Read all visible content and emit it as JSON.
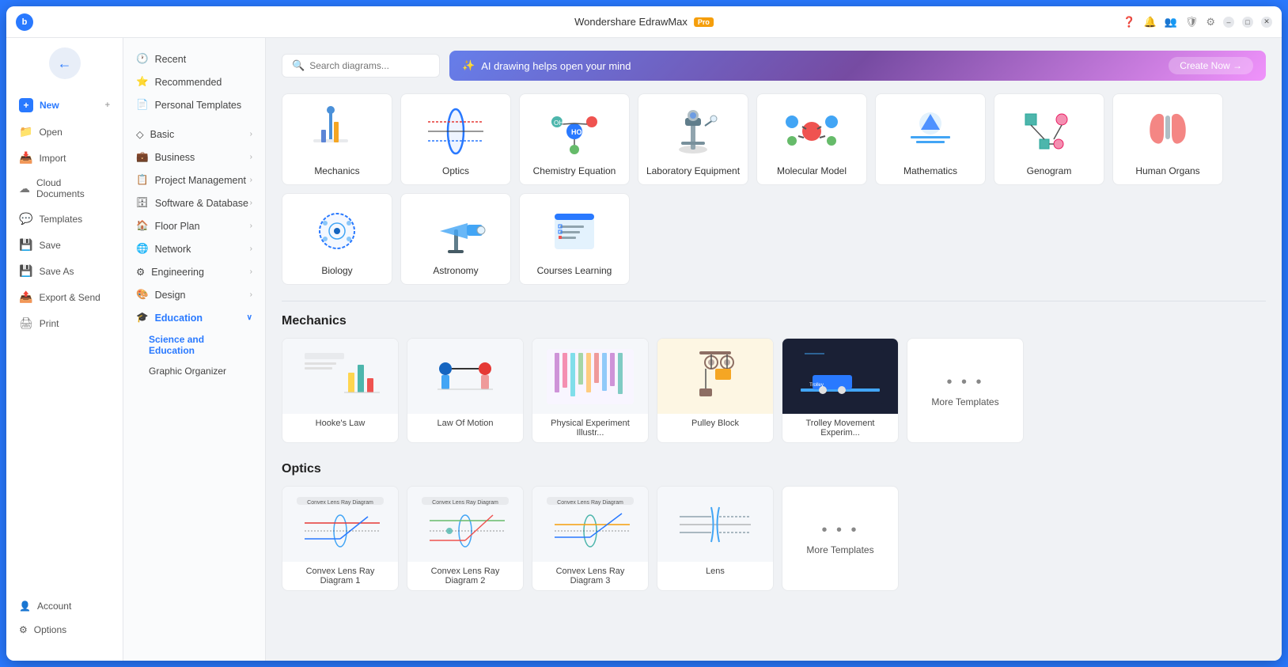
{
  "app": {
    "title": "Wondershare EdrawMax",
    "badge": "Pro",
    "avatar": "b"
  },
  "titlebar": {
    "icons": [
      "help",
      "bell",
      "people",
      "shield",
      "settings"
    ]
  },
  "left_sidebar": {
    "items": [
      {
        "id": "new",
        "label": "New",
        "icon": "+"
      },
      {
        "id": "open",
        "label": "Open",
        "icon": "📁"
      },
      {
        "id": "import",
        "label": "Import",
        "icon": "📥"
      },
      {
        "id": "cloud",
        "label": "Cloud Documents",
        "icon": "☁"
      },
      {
        "id": "templates",
        "label": "Templates",
        "icon": "💬"
      },
      {
        "id": "save",
        "label": "Save",
        "icon": "💾"
      },
      {
        "id": "save-as",
        "label": "Save As",
        "icon": "💾"
      },
      {
        "id": "export",
        "label": "Export & Send",
        "icon": "📤"
      },
      {
        "id": "print",
        "label": "Print",
        "icon": "🖨"
      }
    ],
    "bottom": [
      {
        "id": "account",
        "label": "Account",
        "icon": "👤"
      },
      {
        "id": "options",
        "label": "Options",
        "icon": "⚙"
      }
    ]
  },
  "main_sidebar": {
    "items": [
      {
        "id": "recent",
        "label": "Recent",
        "icon": "🕐",
        "has_sub": false
      },
      {
        "id": "recommended",
        "label": "Recommended",
        "icon": "⭐",
        "has_sub": false
      },
      {
        "id": "personal",
        "label": "Personal Templates",
        "icon": "📄",
        "has_sub": false
      },
      {
        "id": "basic",
        "label": "Basic",
        "icon": "◇",
        "has_chevron": true
      },
      {
        "id": "business",
        "label": "Business",
        "icon": "💼",
        "has_chevron": true
      },
      {
        "id": "project",
        "label": "Project Management",
        "icon": "📋",
        "has_chevron": true
      },
      {
        "id": "software",
        "label": "Software & Database",
        "icon": "🗄",
        "has_chevron": true
      },
      {
        "id": "floor",
        "label": "Floor Plan",
        "icon": "🏠",
        "has_chevron": true
      },
      {
        "id": "network",
        "label": "Network",
        "icon": "🌐",
        "has_chevron": true
      },
      {
        "id": "engineering",
        "label": "Engineering",
        "icon": "⚙",
        "has_chevron": true
      },
      {
        "id": "design",
        "label": "Design",
        "icon": "🎨",
        "has_chevron": true
      },
      {
        "id": "education",
        "label": "Education",
        "icon": "🎓",
        "has_chevron": true,
        "active": true
      }
    ],
    "sub_items": [
      {
        "id": "science",
        "label": "Science and Education",
        "active": true
      },
      {
        "id": "graphic",
        "label": "Graphic Organizer",
        "active": false
      }
    ]
  },
  "search": {
    "placeholder": "Search diagrams..."
  },
  "ai_banner": {
    "text": "AI drawing helps open your mind",
    "cta": "Create Now →",
    "icon": "✨"
  },
  "categories": [
    {
      "id": "mechanics",
      "label": "Mechanics",
      "color": "#e8f0fe"
    },
    {
      "id": "optics",
      "label": "Optics",
      "color": "#e8f0fe"
    },
    {
      "id": "chemistry",
      "label": "Chemistry Equation",
      "color": "#e8f0fe"
    },
    {
      "id": "lab",
      "label": "Laboratory Equipment",
      "color": "#e8f0fe"
    },
    {
      "id": "molecular",
      "label": "Molecular Model",
      "color": "#e8f0fe"
    },
    {
      "id": "mathematics",
      "label": "Mathematics",
      "color": "#e8f0fe"
    },
    {
      "id": "genogram",
      "label": "Genogram",
      "color": "#e8f0fe"
    },
    {
      "id": "human",
      "label": "Human Organs",
      "color": "#fce8e8"
    },
    {
      "id": "biology",
      "label": "Biology",
      "color": "#e8f0fe"
    },
    {
      "id": "astronomy",
      "label": "Astronomy",
      "color": "#e8f0fe"
    },
    {
      "id": "courses",
      "label": "Courses Learning",
      "color": "#e8f0fe"
    }
  ],
  "sections": [
    {
      "title": "Mechanics",
      "templates": [
        {
          "id": "hookes",
          "label": "Hooke's Law",
          "bg": "#f5f7fa"
        },
        {
          "id": "law-motion",
          "label": "Law Of Motion",
          "bg": "#f5f7fa"
        },
        {
          "id": "physical",
          "label": "Physical Experiment Illustr...",
          "bg": "#f5f7fa"
        },
        {
          "id": "pulley",
          "label": "Pulley Block",
          "bg": "#fdf6e3"
        },
        {
          "id": "trolley",
          "label": "Trolley Movement Experim...",
          "bg": "#1a2035"
        }
      ],
      "more_label": "More Templates"
    },
    {
      "title": "Optics",
      "templates": [
        {
          "id": "convex1",
          "label": "Convex Lens Ray Diagram 1",
          "bg": "#f5f7fa"
        },
        {
          "id": "convex2",
          "label": "Convex Lens Ray Diagram 2",
          "bg": "#f5f7fa"
        },
        {
          "id": "convex3",
          "label": "Convex Lens Ray Diagram 3",
          "bg": "#f5f7fa"
        },
        {
          "id": "lens",
          "label": "Lens",
          "bg": "#f5f7fa"
        }
      ],
      "more_label": "More Templates"
    }
  ]
}
